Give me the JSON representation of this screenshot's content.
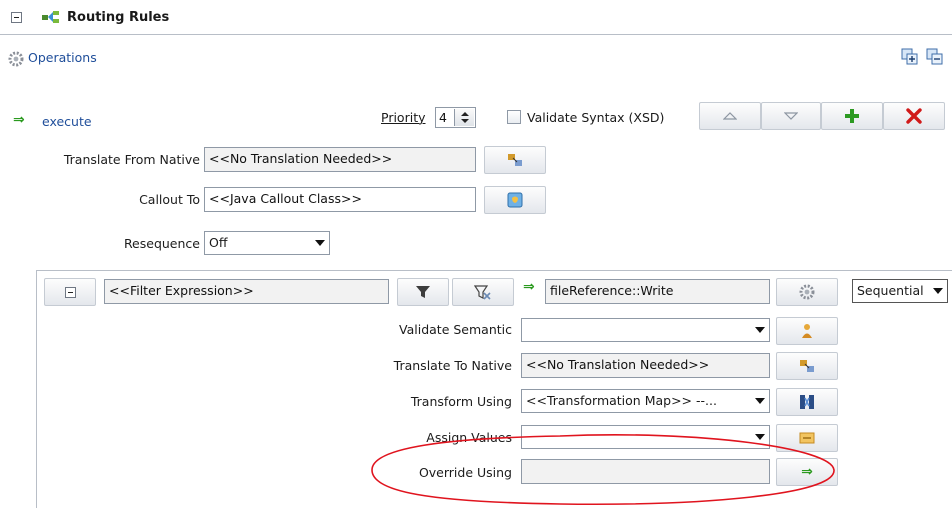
{
  "header": {
    "title": "Routing Rules"
  },
  "operations": {
    "label": "Operations"
  },
  "execute": {
    "label": "execute"
  },
  "priority": {
    "label": "Priority",
    "value": "4"
  },
  "validate_syntax": {
    "label": "Validate Syntax (XSD)",
    "checked": false
  },
  "translate_from_native": {
    "label": "Translate From Native",
    "value": "<<No Translation Needed>>"
  },
  "callout_to": {
    "label": "Callout To",
    "value": "<<Java Callout Class>>"
  },
  "resequence": {
    "label": "Resequence",
    "value": "Off"
  },
  "filter": {
    "expression": "<<Filter Expression>>",
    "target": "fileReference::Write",
    "mode": "Sequential"
  },
  "routing": {
    "validate_semantic": {
      "label": "Validate Semantic",
      "value": ""
    },
    "translate_to_native": {
      "label": "Translate To Native",
      "value": "<<No Translation Needed>>"
    },
    "transform_using": {
      "label": "Transform Using",
      "value": "<<Transformation Map>> --..."
    },
    "assign_values": {
      "label": "Assign Values",
      "value": ""
    },
    "override_using": {
      "label": "Override Using",
      "value": ""
    }
  },
  "colors": {
    "link": "#1f4e9a",
    "highlight_ellipse": "#e0141e",
    "green_arrow": "#2b9a1f",
    "red_x": "#d11a1a"
  }
}
